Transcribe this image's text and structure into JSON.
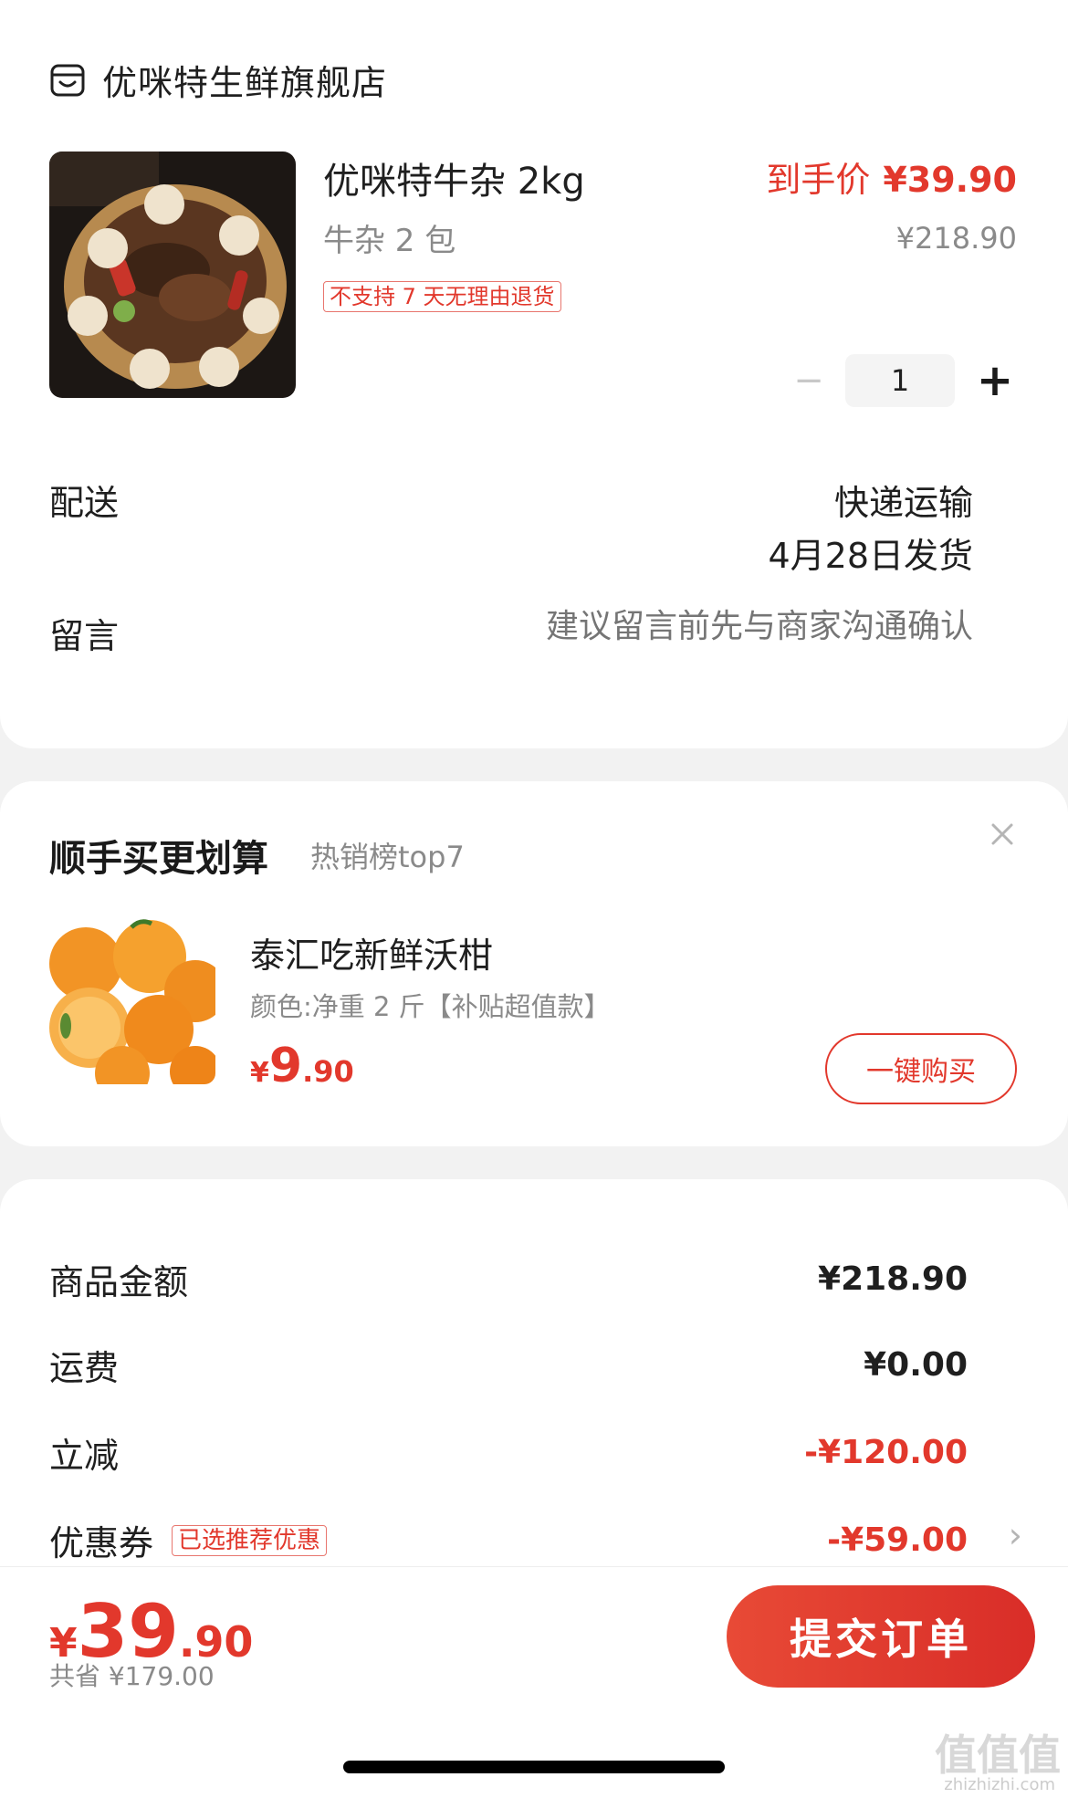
{
  "store": {
    "name": "优咪特生鲜旗舰店",
    "icon": "store-icon"
  },
  "product": {
    "title": "优咪特牛杂 2kg",
    "spec": "牛杂 2 包",
    "return_tag": "不支持 7 天无理由退货",
    "final_price_label": "到手价",
    "final_price": "¥39.90",
    "original_price": "¥218.90",
    "quantity": "1",
    "minus_symbol": "−",
    "plus_symbol": "+"
  },
  "delivery": {
    "label": "配送",
    "method": "快递运输",
    "ship_date": "4月28日发货"
  },
  "message": {
    "label": "留言",
    "placeholder": "建议留言前先与商家沟通确认"
  },
  "upsell": {
    "title": "顺手买更划算",
    "subtitle": "热销榜top7",
    "item": {
      "name": "泰汇吃新鲜沃柑",
      "spec": "颜色:净重 2 斤【补贴超值款】",
      "price_currency": "¥",
      "price_int": "9",
      "price_dec": ".90"
    },
    "buy_label": "一键购买"
  },
  "summary": {
    "rows": [
      {
        "label": "商品金额",
        "value": "¥218.90"
      },
      {
        "label": "运费",
        "value": "¥0.00"
      },
      {
        "label": "立减",
        "value": "-¥120.00"
      },
      {
        "label": "优惠券",
        "tag": "已选推荐优惠",
        "value": "-¥59.00"
      }
    ],
    "chevron": "›"
  },
  "bottom": {
    "total_currency": "¥",
    "total_int": "39",
    "total_dec": ".90",
    "saved": "共省 ¥179.00",
    "submit_label": "提交订单"
  },
  "watermark": {
    "text": "值值值",
    "url": "zhizhizhi.com"
  },
  "colors": {
    "accent": "#e2382c",
    "muted": "#8a8a8a",
    "placeholder": "#b5b5b5",
    "background": "#f2f2f2"
  }
}
